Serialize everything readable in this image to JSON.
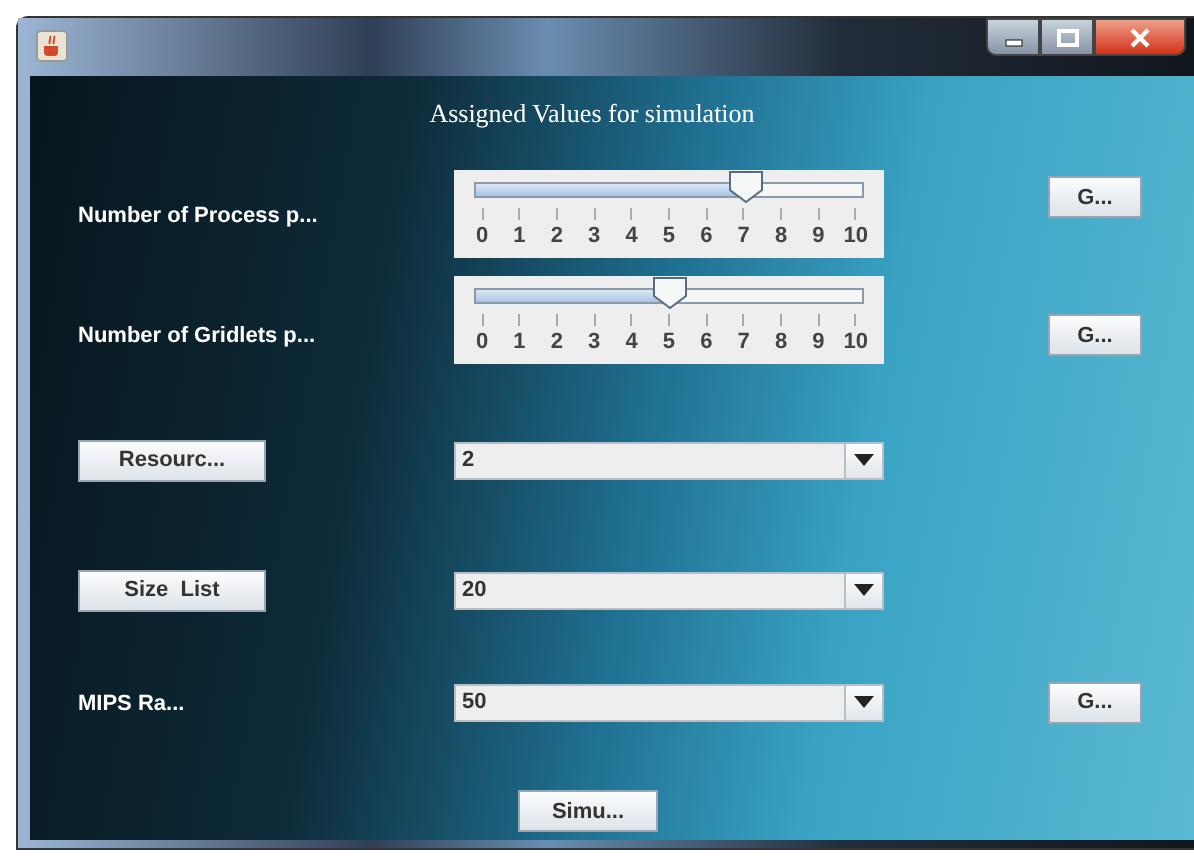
{
  "title": "Assigned Values for simulation",
  "rows": [
    {
      "label": {
        "kind": "text",
        "text": "Number of Process p..."
      },
      "control": {
        "kind": "slider",
        "level": 0.7,
        "ticks": [
          "0",
          "1",
          "2",
          "3",
          "4",
          "5",
          "6",
          "7",
          "8",
          "9",
          "10"
        ]
      },
      "action": "G..."
    },
    {
      "label": {
        "kind": "text",
        "text": "Number of Gridlets p..."
      },
      "control": {
        "kind": "slider",
        "level": 0.5,
        "ticks": [
          "0",
          "1",
          "2",
          "3",
          "4",
          "5",
          "6",
          "7",
          "8",
          "9",
          "10"
        ]
      },
      "action": "G..."
    },
    {
      "label": {
        "kind": "button",
        "text": "Resourc..."
      },
      "control": {
        "kind": "combo",
        "value": "2"
      }
    },
    {
      "label": {
        "kind": "button",
        "text": "Size  List"
      },
      "control": {
        "kind": "combo",
        "value": "20"
      }
    },
    {
      "label": {
        "kind": "text",
        "text": "MIPS Ra..."
      },
      "control": {
        "kind": "combo",
        "value": "50"
      },
      "action": "G..."
    }
  ],
  "submit": "Simu..."
}
